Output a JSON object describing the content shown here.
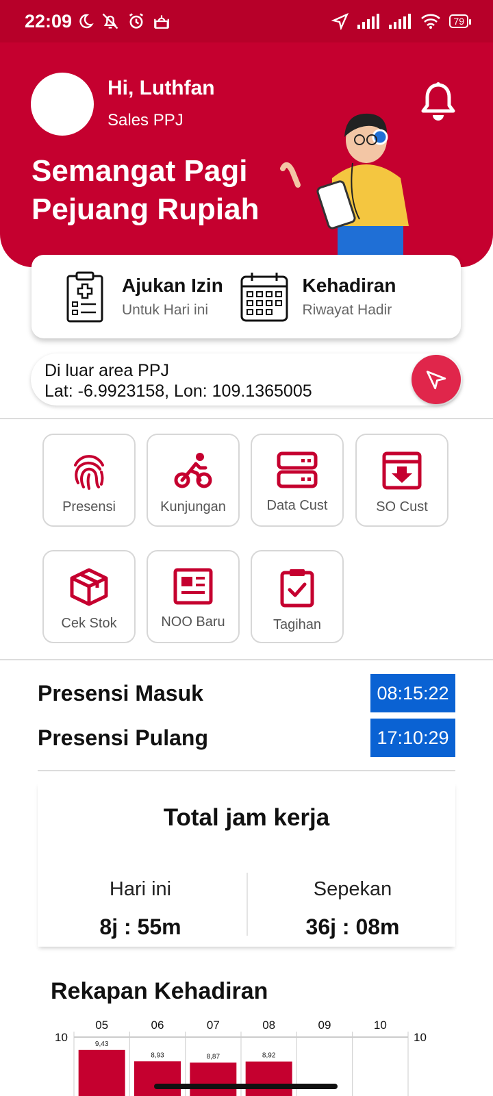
{
  "status_bar": {
    "time": "22:09",
    "battery": "79"
  },
  "header": {
    "greeting": "Hi, Luthfan",
    "role": "Sales PPJ",
    "motto_line1": "Semangat Pagi",
    "motto_line2": "Pejuang Rupiah"
  },
  "quick_actions": [
    {
      "title": "Ajukan Izin",
      "subtitle": "Untuk Hari ini",
      "icon": "clipboard-medical-icon"
    },
    {
      "title": "Kehadiran",
      "subtitle": "Riwayat Hadir",
      "icon": "calendar-icon"
    }
  ],
  "location": {
    "status": "Di luar area PPJ",
    "coords": "Lat: -6.9923158, Lon: 109.1365005"
  },
  "menu": [
    {
      "label": "Presensi",
      "icon": "fingerprint-icon"
    },
    {
      "label": "Kunjungan",
      "icon": "bicycle-icon"
    },
    {
      "label": "Data Cust",
      "icon": "server-icon"
    },
    {
      "label": "SO Cust",
      "icon": "archive-download-icon"
    },
    {
      "label": "Cek Stok",
      "icon": "box-icon"
    },
    {
      "label": "NOO Baru",
      "icon": "newspaper-icon"
    },
    {
      "label": "Tagihan",
      "icon": "clipboard-check-icon"
    }
  ],
  "presensi": {
    "masuk_label": "Presensi Masuk",
    "masuk_time": "08:15:22",
    "pulang_label": "Presensi Pulang",
    "pulang_time": "17:10:29"
  },
  "total": {
    "title": "Total jam kerja",
    "today_label": "Hari ini",
    "today_value": "8j : 55m",
    "week_label": "Sepekan",
    "week_value": "36j : 08m"
  },
  "rekap": {
    "title": "Rekapan Kehadiran"
  },
  "colors": {
    "primary": "#c5002f",
    "blue": "#0a62d3"
  },
  "chart_data": {
    "type": "bar",
    "categories": [
      "05",
      "06",
      "07",
      "08",
      "09",
      "10"
    ],
    "values": [
      9.43,
      8.93,
      8.87,
      8.92,
      null,
      null
    ],
    "value_labels": [
      "9,43",
      "8,93",
      "8,87",
      "8,92",
      "",
      ""
    ],
    "ytick_label": "10",
    "ylim": [
      0,
      10
    ]
  }
}
